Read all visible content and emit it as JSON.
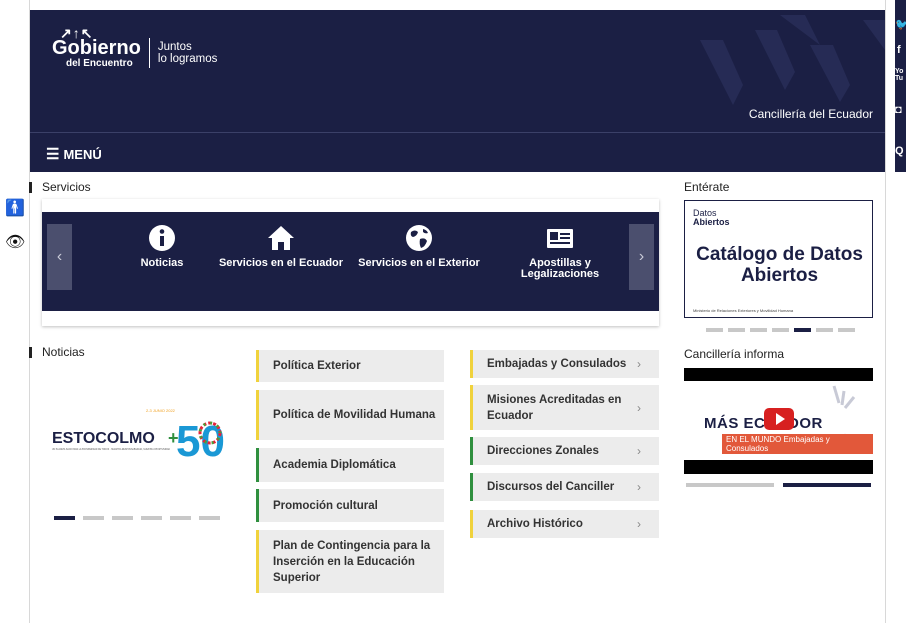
{
  "header": {
    "logo_rays": "↗↑↖",
    "logo_main": "Gobierno",
    "logo_sub": "del Encuentro",
    "slogan_line1": "Juntos",
    "slogan_line2": "lo logramos",
    "site_name": "Cancillería del Ecuador"
  },
  "menu": {
    "label": "MENÚ",
    "icon": "hamburger-icon"
  },
  "social": {
    "icons": [
      "twitter-icon",
      "facebook-icon",
      "youtube-icon",
      "instagram-icon",
      "search-icon"
    ],
    "youtube_short": "Yo Tu"
  },
  "accessibility": {
    "icons": [
      "accessibility-person-icon",
      "eye-icon"
    ]
  },
  "servicios": {
    "title": "Servicios",
    "items": [
      {
        "label": "Noticias",
        "icon": "info-icon"
      },
      {
        "label": "Servicios en el Ecuador",
        "icon": "home-icon"
      },
      {
        "label": "Servicios en el Exterior",
        "icon": "globe-icon"
      },
      {
        "label": "Apostillas y Legalizaciones",
        "icon": "id-card-icon"
      }
    ],
    "prev": "‹",
    "next": "›"
  },
  "noticias": {
    "title": "Noticias",
    "banner_word": "ESTOCOLMO",
    "banner_plus": "+",
    "banner_number": "50",
    "banner_date": "2-3 JUNIO 2022",
    "banner_tagline": "UN PLANETA SANO PARA LA PROSPERIDAD DE TODOS · NUESTRA RESPONSABILIDAD, NUESTRA OPORTUNIDAD",
    "dots_count": 6,
    "active_dot": 0
  },
  "links_left": [
    {
      "label": "Política Exterior",
      "accent": "yellow"
    },
    {
      "label": "Política de Movilidad Humana",
      "accent": "yellow"
    },
    {
      "label": "Academia Diplomática",
      "accent": "green"
    },
    {
      "label": "Promoción cultural",
      "accent": "green"
    },
    {
      "label": "Plan de Contingencia para la Inserción en la Educación Superior",
      "accent": "yellow"
    }
  ],
  "links_right": [
    {
      "label": "Embajadas y Consulados",
      "accent": "yellow"
    },
    {
      "label": "Misiones Acreditadas en Ecuador",
      "accent": "yellow"
    },
    {
      "label": "Direcciones Zonales",
      "accent": "green"
    },
    {
      "label": "Discursos del Canciller",
      "accent": "green"
    },
    {
      "label": "Archivo Histórico",
      "accent": "yellow"
    }
  ],
  "chevron": "›",
  "enterate": {
    "title": "Entérate",
    "logo_line1": "Datos",
    "logo_line2": "Abiertos",
    "card_title": "Catálogo de Datos Abiertos",
    "card_footer": "Ministerio de Relaciones Exteriores y Movilidad Humana",
    "dots_count": 7,
    "active_dot": 4
  },
  "cancilleria_informa": {
    "title": "Cancillería informa",
    "text_main": "MÁS ECUADOR",
    "text_line2": "EN EL MUNDO",
    "text_sub": "Embajadas y Consulados",
    "dots_count": 2,
    "active_dot": 1
  },
  "colors": {
    "navy": "#1b1f44",
    "yellow_accent": "#f0d23c",
    "green_accent": "#2f8f3e"
  }
}
